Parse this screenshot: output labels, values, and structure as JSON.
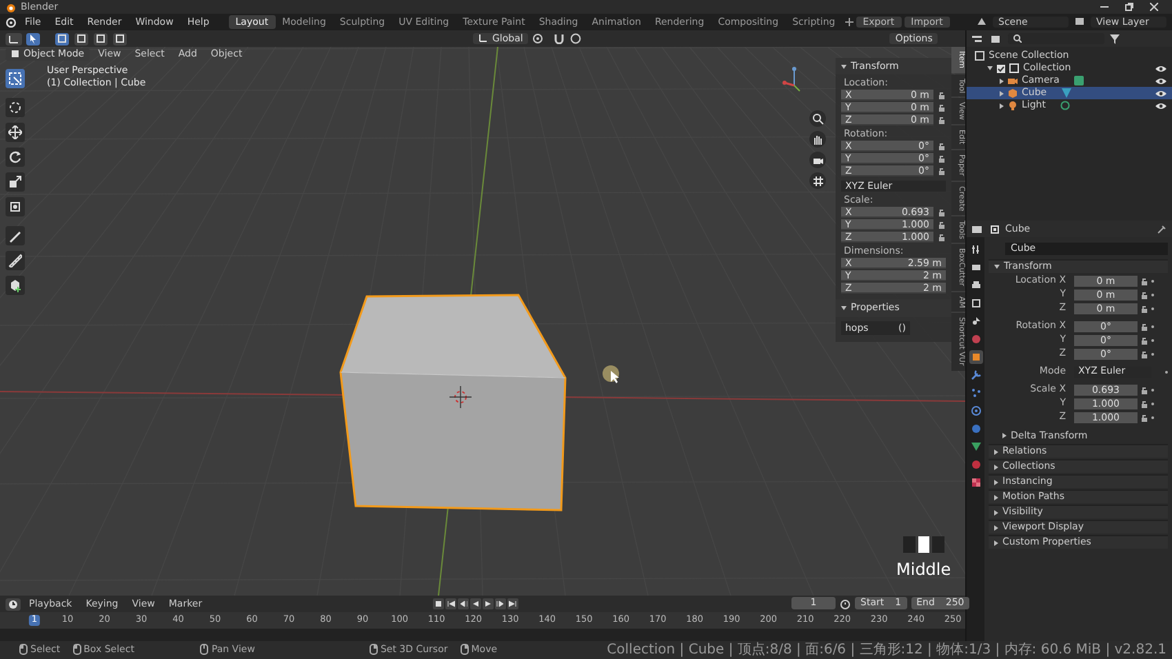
{
  "window": {
    "title": "Blender"
  },
  "menu": [
    "File",
    "Edit",
    "Render",
    "Window",
    "Help"
  ],
  "workspaces": [
    {
      "label": "Layout",
      "selected": true
    },
    {
      "label": "Modeling",
      "selected": false
    },
    {
      "label": "Sculpting",
      "selected": false
    },
    {
      "label": "UV Editing",
      "selected": false
    },
    {
      "label": "Texture Paint",
      "selected": false
    },
    {
      "label": "Shading",
      "selected": false
    },
    {
      "label": "Animation",
      "selected": false
    },
    {
      "label": "Rendering",
      "selected": false
    },
    {
      "label": "Compositing",
      "selected": false
    },
    {
      "label": "Scripting",
      "selected": false
    }
  ],
  "addon_buttons": [
    "Export",
    "Import"
  ],
  "scene": "Scene",
  "view_layer": "View Layer",
  "viewport": {
    "orientation": "Global",
    "options": "Options",
    "mode": "Object Mode",
    "menus": [
      "View",
      "Select",
      "Add",
      "Object"
    ],
    "info": [
      "User Perspective",
      "(1) Collection | Cube"
    ],
    "key_hint": "Middle"
  },
  "tools": [
    {
      "kind": "select",
      "selected": true
    },
    {
      "kind": "cursor",
      "selected": false
    },
    {
      "kind": "move",
      "selected": false
    },
    {
      "kind": "rotate",
      "selected": false
    },
    {
      "kind": "scale",
      "selected": false
    },
    {
      "kind": "transform",
      "selected": false
    },
    {
      "kind": "annotate",
      "selected": false
    },
    {
      "kind": "measure",
      "selected": false
    },
    {
      "kind": "add",
      "selected": false
    }
  ],
  "sidebar": {
    "tabs": [
      {
        "label": "Item",
        "selected": true
      },
      {
        "label": "Tool",
        "selected": false
      },
      {
        "label": "View",
        "selected": false
      },
      {
        "label": "Edit",
        "selected": false
      },
      {
        "label": "Paper",
        "selected": false
      },
      {
        "label": "Create",
        "selected": false
      },
      {
        "label": "Tools",
        "selected": false
      },
      {
        "label": "BoxCutter",
        "selected": false
      },
      {
        "label": "AM",
        "selected": false
      },
      {
        "label": "Shortcut VUr",
        "selected": false
      }
    ],
    "panels": [
      {
        "title": "Transform",
        "expanded": true,
        "rows": [
          {
            "kind": "heading",
            "label": "Location:"
          },
          {
            "kind": "field",
            "axis": "X",
            "value": "0 m"
          },
          {
            "kind": "field",
            "axis": "Y",
            "value": "0 m"
          },
          {
            "kind": "field",
            "axis": "Z",
            "value": "0 m"
          },
          {
            "kind": "heading",
            "label": "Rotation:"
          },
          {
            "kind": "field",
            "axis": "X",
            "value": "0°"
          },
          {
            "kind": "field",
            "axis": "Y",
            "value": "0°"
          },
          {
            "kind": "field",
            "axis": "Z",
            "value": "0°"
          },
          {
            "kind": "dropdown",
            "value": "XYZ Euler"
          },
          {
            "kind": "heading",
            "label": "Scale:"
          },
          {
            "kind": "field",
            "axis": "X",
            "value": "0.693"
          },
          {
            "kind": "field",
            "axis": "Y",
            "value": "1.000"
          },
          {
            "kind": "field",
            "axis": "Z",
            "value": "1.000"
          },
          {
            "kind": "heading",
            "label": "Dimensions:"
          },
          {
            "kind": "wide",
            "axis": "X",
            "value": "2.59 m"
          },
          {
            "kind": "wide",
            "axis": "Y",
            "value": "2 m"
          },
          {
            "kind": "wide",
            "axis": "Z",
            "value": "2 m"
          }
        ]
      },
      {
        "title": "Properties",
        "expanded": true,
        "rows": [
          {
            "kind": "pair",
            "label": "hops",
            "value": "()"
          }
        ]
      }
    ]
  },
  "outliner": {
    "root": "Scene Collection",
    "items": [
      {
        "label": "Collection",
        "kind": "collection",
        "expanded": true,
        "selected": false,
        "children": [
          {
            "label": "Camera",
            "kind": "camera",
            "expanded": false,
            "selected": false
          },
          {
            "label": "Cube",
            "kind": "mesh",
            "expanded": false,
            "selected": true
          },
          {
            "label": "Light",
            "kind": "light",
            "expanded": false,
            "selected": false
          }
        ]
      }
    ]
  },
  "properties": {
    "object": "Cube",
    "name": "Cube",
    "tabs": [
      {
        "kind": "tool",
        "selected": false
      },
      {
        "kind": "render",
        "selected": false
      },
      {
        "kind": "output",
        "selected": false
      },
      {
        "kind": "viewlayer",
        "selected": false
      },
      {
        "kind": "scene",
        "selected": false
      },
      {
        "kind": "world",
        "selected": false
      },
      {
        "kind": "object",
        "selected": true
      },
      {
        "kind": "modifier",
        "selected": false
      },
      {
        "kind": "particles",
        "selected": false
      },
      {
        "kind": "physics",
        "selected": false
      },
      {
        "kind": "constraint",
        "selected": false
      },
      {
        "kind": "data",
        "selected": false
      },
      {
        "kind": "material",
        "selected": false
      },
      {
        "kind": "texture",
        "selected": false
      }
    ],
    "transform": {
      "title": "Transform",
      "expanded": true,
      "rows": [
        {
          "kind": "field",
          "label": "Location X",
          "value": "0 m"
        },
        {
          "kind": "field",
          "label": "Y",
          "value": "0 m"
        },
        {
          "kind": "field",
          "label": "Z",
          "value": "0 m"
        },
        {
          "kind": "field",
          "label": "Rotation X",
          "value": "0°"
        },
        {
          "kind": "field",
          "label": "Y",
          "value": "0°"
        },
        {
          "kind": "field",
          "label": "Z",
          "value": "0°"
        },
        {
          "kind": "dropdown",
          "label": "Mode",
          "value": "XYZ Euler"
        },
        {
          "kind": "field",
          "label": "Scale X",
          "value": "0.693"
        },
        {
          "kind": "field",
          "label": "Y",
          "value": "1.000"
        },
        {
          "kind": "field",
          "label": "Z",
          "value": "1.000"
        }
      ],
      "subpanel": {
        "title": "Delta Transform",
        "expanded": false
      }
    },
    "panels": [
      {
        "title": "Relations",
        "expanded": false
      },
      {
        "title": "Collections",
        "expanded": false
      },
      {
        "title": "Instancing",
        "expanded": false
      },
      {
        "title": "Motion Paths",
        "expanded": false
      },
      {
        "title": "Visibility",
        "expanded": false
      },
      {
        "title": "Viewport Display",
        "expanded": false
      },
      {
        "title": "Custom Properties",
        "expanded": false
      }
    ]
  },
  "timeline": {
    "menus": [
      "Playback",
      "Keying",
      "View",
      "Marker"
    ],
    "frame": "1",
    "start_label": "Start",
    "start": "1",
    "end_label": "End",
    "end": "250",
    "marks": [
      {
        "label": "1",
        "selected": true
      },
      {
        "label": "10",
        "selected": false
      },
      {
        "label": "20",
        "selected": false
      },
      {
        "label": "30",
        "selected": false
      },
      {
        "label": "40",
        "selected": false
      },
      {
        "label": "50",
        "selected": false
      },
      {
        "label": "60",
        "selected": false
      },
      {
        "label": "70",
        "selected": false
      },
      {
        "label": "80",
        "selected": false
      },
      {
        "label": "90",
        "selected": false
      },
      {
        "label": "100",
        "selected": false
      },
      {
        "label": "110",
        "selected": false
      },
      {
        "label": "120",
        "selected": false
      },
      {
        "label": "130",
        "selected": false
      },
      {
        "label": "140",
        "selected": false
      },
      {
        "label": "150",
        "selected": false
      },
      {
        "label": "160",
        "selected": false
      },
      {
        "label": "170",
        "selected": false
      },
      {
        "label": "180",
        "selected": false
      },
      {
        "label": "190",
        "selected": false
      },
      {
        "label": "200",
        "selected": false
      },
      {
        "label": "210",
        "selected": false
      },
      {
        "label": "220",
        "selected": false
      },
      {
        "label": "230",
        "selected": false
      },
      {
        "label": "240",
        "selected": false
      },
      {
        "label": "250",
        "selected": false
      }
    ]
  },
  "status_bar": {
    "hints": [
      {
        "kind": "lmb",
        "label": "Select"
      },
      {
        "kind": "lmb",
        "label": "Box Select"
      },
      {
        "kind": "mmb",
        "label": "Pan View"
      },
      {
        "kind": "rmb",
        "label": "Set 3D Cursor"
      },
      {
        "kind": "rmb",
        "label": "Move"
      }
    ],
    "stats": "Collection | Cube | 顶点:8/8 | 面:6/6 | 三角形:12 | 物体:1/3 | 内存: 60.6 MiB | v2.82.1"
  }
}
